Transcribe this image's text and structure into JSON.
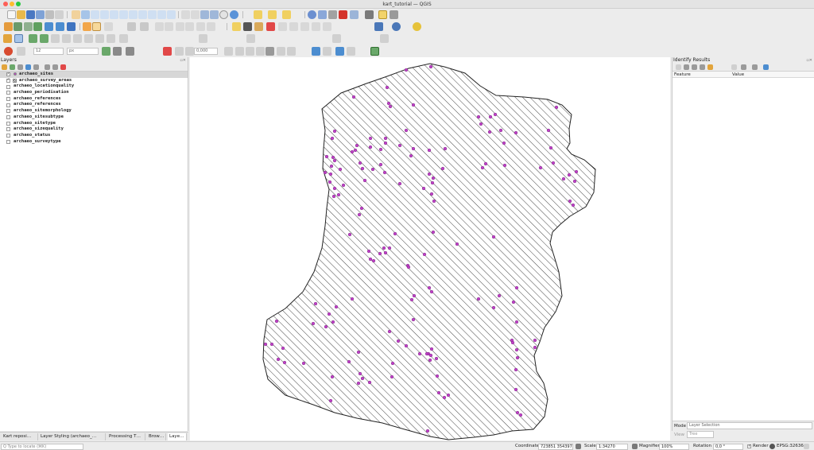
{
  "window": {
    "title": "kart_tutorial — QGIS"
  },
  "toolbar": {
    "scale_input": "12",
    "unit_select": "px",
    "rotation_input": "0,000"
  },
  "layers_panel": {
    "title": "Layers",
    "layers": [
      {
        "name": "archaeo_sites",
        "checked": true,
        "type": "point",
        "selected": true
      },
      {
        "name": "archaeo_survey_areas",
        "checked": true,
        "type": "polygon",
        "selected": false
      },
      {
        "name": "archaeo_locationquality",
        "checked": false,
        "type": "table",
        "selected": false
      },
      {
        "name": "archaeo_periodisation",
        "checked": false,
        "type": "table",
        "selected": false
      },
      {
        "name": "archaeo_references",
        "checked": false,
        "type": "table",
        "selected": false
      },
      {
        "name": "archaeo_references",
        "checked": false,
        "type": "table",
        "selected": false
      },
      {
        "name": "archaeo_sitemorphology",
        "checked": false,
        "type": "table",
        "selected": false
      },
      {
        "name": "archaeo_sitesubtype",
        "checked": false,
        "type": "table",
        "selected": false
      },
      {
        "name": "archaeo_sitetype",
        "checked": false,
        "type": "table",
        "selected": false
      },
      {
        "name": "archaeo_sizequality",
        "checked": false,
        "type": "table",
        "selected": false
      },
      {
        "name": "archaeo_status",
        "checked": false,
        "type": "table",
        "selected": false
      },
      {
        "name": "archaeo_surveytype",
        "checked": false,
        "type": "table",
        "selected": false
      }
    ]
  },
  "bottom_tabs": [
    "Kart reposi…",
    "Layer Styling (archaeo_…",
    "Processing T…",
    "Brow…",
    "Laye…"
  ],
  "identify_panel": {
    "title": "Identify Results",
    "columns": {
      "feature": "Feature",
      "value": "Value"
    },
    "mode_label": "Mode",
    "mode_value": "Layer Selection",
    "view_label": "View",
    "view_value": "Tree"
  },
  "statusbar": {
    "locator_placeholder": "Q  Type to locate (⌘K)",
    "coordinate_label": "Coordinate",
    "coordinate_value": "723851  3543978",
    "scale_label": "Scale",
    "scale_value": "1:34270",
    "magnifier_label": "Magnifier",
    "magnifier_value": "100%",
    "rotation_label": "Rotation",
    "rotation_value": "0,0 °",
    "render_label": "Render",
    "crs_label": "EPSG:32636"
  },
  "map": {
    "point_color": "#c040c8",
    "hatch_color": "#333333"
  }
}
